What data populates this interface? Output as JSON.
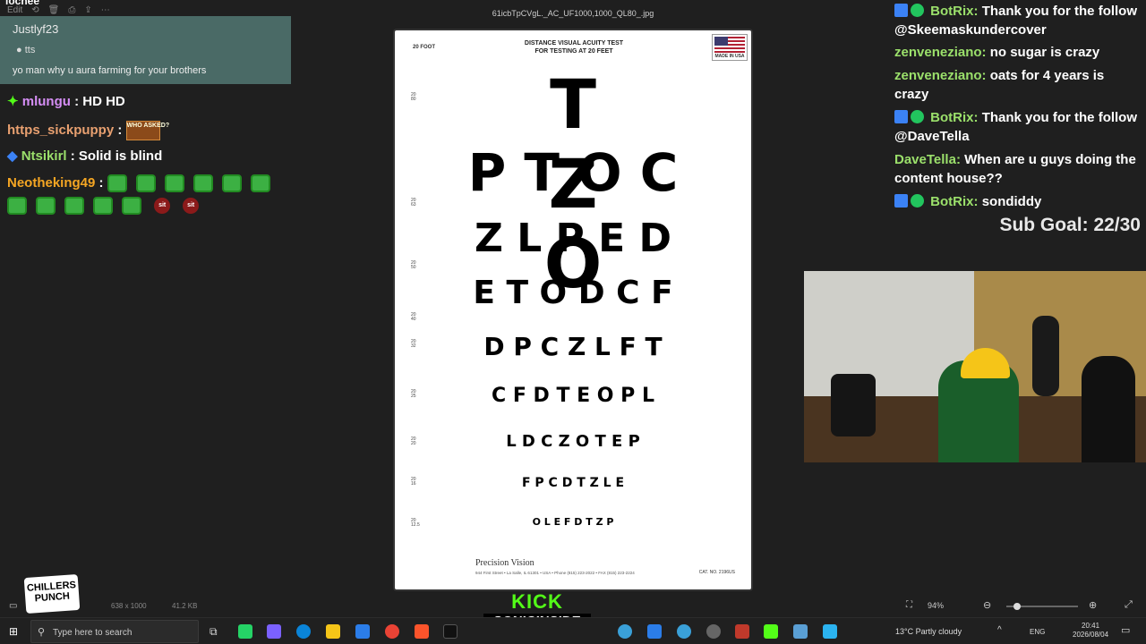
{
  "viewer": {
    "file_title": "61icbTpCVgL._AC_UF1000,1000_QL80_.jpg",
    "left_title": "lochee",
    "toolbar_edit": "Edit",
    "status_dims": "638 x 1000",
    "status_size": "41.2 KB",
    "zoom": "94%",
    "zoom_fraction": 0.15
  },
  "chart": {
    "header_line1": "DISTANCE VISUAL ACUITY TEST",
    "header_line2": "FOR TESTING AT 20 FEET",
    "feet_label": "20 FOOT",
    "made_in": "MADE IN USA",
    "rows": [
      {
        "letters": "T Z O",
        "snell": "20 80"
      },
      {
        "letters": "P T O C",
        "snell": ""
      },
      {
        "letters": "Z L P E D",
        "snell": "20 63"
      },
      {
        "letters": "E T O D C F",
        "snell": "20 50"
      },
      {
        "letters": "D P C Z L F T",
        "snell": "20 40"
      },
      {
        "letters": "C F D T E O P L",
        "snell": "20 32"
      },
      {
        "letters": "L D C Z O T E P",
        "snell": "20 25"
      },
      {
        "letters": "F P C D T Z L E",
        "snell": "20 20"
      },
      {
        "letters": "O L E F D T Z P",
        "snell": "20 16"
      },
      {
        "letters": "",
        "snell": "20 12.5"
      }
    ],
    "brand": "Precision Vision",
    "address": "944 First Street • La Salle, IL 61301 • USA • Phone (815) 223-2022 • FAX (815) 223-2224",
    "catalog": "CAT. NO. 2196US"
  },
  "left_chat": {
    "tts_user": "Justlyf23",
    "tts_tag": "tts",
    "tts_message": "yo man why u aura farming for your brothers",
    "messages": [
      {
        "user": "mlungu",
        "text": "HD HD",
        "color": "#d58ef5"
      },
      {
        "user": "https_sickpuppy",
        "text": "",
        "color": "#e8a070"
      },
      {
        "user": "Ntsikirl",
        "text": "Solid is blind",
        "color": "#9be06b"
      },
      {
        "user": "Neotheking49",
        "text": "",
        "color": "#f5a623"
      }
    ],
    "who_badge": "WHO ASKED?",
    "sit_label": "sit"
  },
  "right_chat": {
    "messages": [
      {
        "user": "BotRix",
        "text": "Thank you for the follow @Skeemaskundercover"
      },
      {
        "user": "zenveneziano",
        "text": "no sugar is crazy"
      },
      {
        "user": "zenveneziano",
        "text": "oats for 4 years is crazy"
      },
      {
        "user": "BotRix",
        "text": "Thank you for the follow @DaveTella"
      },
      {
        "user": "DaveTella",
        "text": "When are u guys doing the content house??"
      },
      {
        "user": "BotRix",
        "text": "sondiddy"
      }
    ],
    "sub_goal": "Sub Goal: 22/30"
  },
  "overlay": {
    "chillers_line1": "CHILLERS",
    "chillers_line2": "PUNCH",
    "kick": "KICK",
    "channel": "SONICINSIDE"
  },
  "taskbar": {
    "search_placeholder": "Type here to search",
    "weather": "13°C  Partly cloudy",
    "lang": "ENG",
    "time": "20:41",
    "date": "2026/08/04"
  }
}
